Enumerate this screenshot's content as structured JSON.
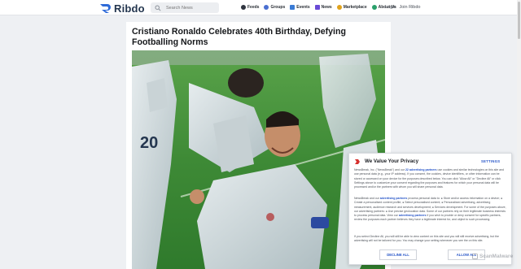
{
  "header": {
    "logo_text": "Ribdo",
    "search_placeholder": "Search News",
    "nav": [
      {
        "label": "Feeds",
        "icon": "feeds-icon",
        "color": "#2f3540"
      },
      {
        "label": "Groups",
        "icon": "groups-icon",
        "color": "#4a6fd1"
      },
      {
        "label": "Events",
        "icon": "events-icon",
        "color": "#3a7bd5"
      },
      {
        "label": "News",
        "icon": "news-icon",
        "color": "#6a4bd6"
      },
      {
        "label": "Marketplace",
        "icon": "marketplace-icon",
        "color": "#e0a21b"
      },
      {
        "label": "About Us",
        "icon": "about-icon",
        "color": "#2aa06b"
      }
    ],
    "login": "Login",
    "join": "Join Ribdo"
  },
  "article": {
    "title": "Cristiano Ronaldo Celebrates 40th Birthday, Defying Footballing Norms",
    "image_alt": "Football players celebrating on pitch"
  },
  "consent": {
    "title": "We Value Your Privacy",
    "settings": "SETTINGS",
    "p1": {
      "a": "NewsBreak, Inc. (\"NewsBreak\") and our ",
      "link": "22 advertising partners",
      "b": " use cookies and similar technologies on this site and use personal data (e.g., your IP address). If you consent, the cookies, device identifiers, or other information can be stored or accessed on your device for the purposes described below. You can click \"Allow All\" or \"Decline All\" or click Settings above to customize your consent regarding the purposes and features for which your personal data will be processed and/or the partners with whom you will share personal data."
    },
    "p2": {
      "a": "NewsBreak and our ",
      "link1": "advertising partners",
      "b": " process personal data to: ● Store and/or access information on a device; ● Create a personalised content profile; ● Select personalised content; ● Personalised advertising, advertising measurement, audience research and services development; ● Services development. For some of the purposes above, our advertising partners: ● Use precise geolocation data. Some of our partners rely on their legitimate business interests to process personal data. View our ",
      "link2": "advertising partners",
      "c": " if you wish to provide or deny consent for specific partners, review the purposes each partner believes they have a legitimate interest for, and object to such processing."
    },
    "p3": "If you select Decline All, you will still be able to view content on this site and you will still receive advertising, but the advertising will not be tailored for you. You may change your setting whenever you see the  on this site.",
    "decline": "DECLINE ALL",
    "allow": "ALLOW ALL"
  },
  "watermark": "ScanMalware",
  "colors": {
    "brand": "#24364f",
    "logo_accent": "#2f6bd8",
    "link": "#2453c7",
    "pitch": "#3e8a36"
  }
}
